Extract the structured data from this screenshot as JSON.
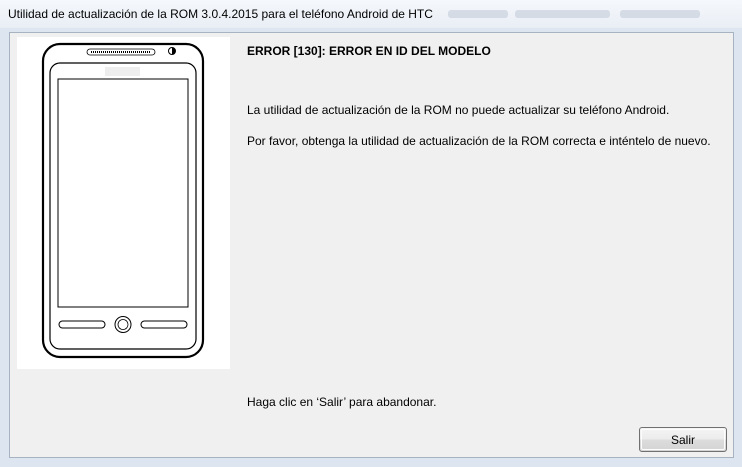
{
  "window": {
    "title": "Utilidad de actualización de la ROM 3.0.4.2015 para el teléfono Android de HTC"
  },
  "message": {
    "error_title": "ERROR [130]: ERROR EN ID DEL MODELO",
    "line1": "La utilidad de actualización de la ROM no puede actualizar su teléfono Android.",
    "line2": "Por favor, obtenga la utilidad de actualización de la ROM correcta e inténtelo de nuevo.",
    "exit_hint": "Haga clic en ‘Salir’ para abandonar."
  },
  "buttons": {
    "exit_label": "Salir"
  },
  "icons": {
    "phone": "phone-illustration"
  }
}
